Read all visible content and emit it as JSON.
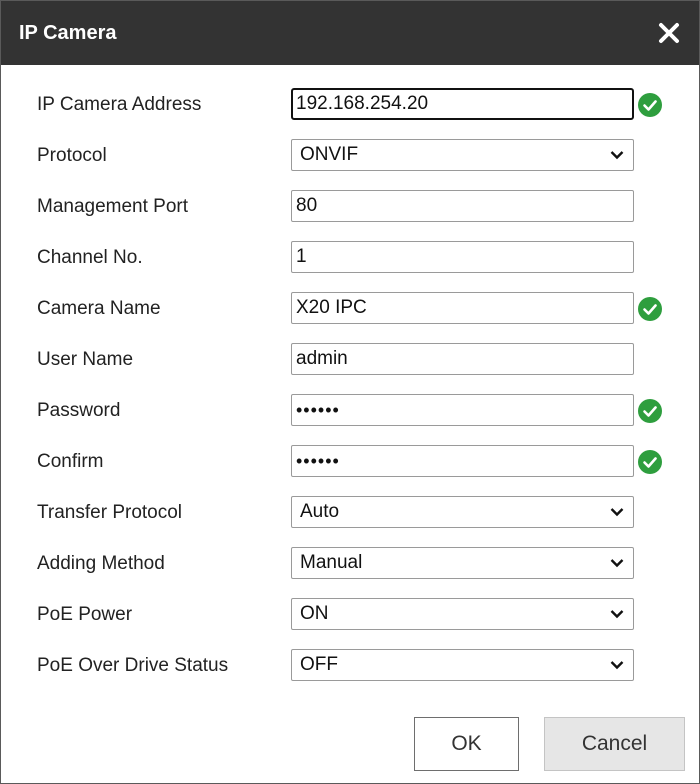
{
  "dialog": {
    "title": "IP Camera"
  },
  "fields": {
    "ip_address": {
      "label": "IP Camera Address",
      "value": "192.168.254.20"
    },
    "protocol": {
      "label": "Protocol",
      "value": "ONVIF"
    },
    "management_port": {
      "label": "Management Port",
      "value": "80"
    },
    "channel_no": {
      "label": "Channel No.",
      "value": "1"
    },
    "camera_name": {
      "label": "Camera Name",
      "value": "X20 IPC"
    },
    "user_name": {
      "label": "User Name",
      "value": "admin"
    },
    "password": {
      "label": "Password",
      "value": "••••••"
    },
    "confirm": {
      "label": "Confirm",
      "value": "••••••"
    },
    "transfer_protocol": {
      "label": "Transfer Protocol",
      "value": "Auto"
    },
    "adding_method": {
      "label": "Adding Method",
      "value": "Manual"
    },
    "poe_power": {
      "label": "PoE Power",
      "value": "ON"
    },
    "poe_over_drive": {
      "label": "PoE Over Drive Status",
      "value": "OFF"
    }
  },
  "buttons": {
    "ok": "OK",
    "cancel": "Cancel"
  },
  "icons": {
    "close": "close-icon",
    "valid": "check-circle-icon",
    "dropdown": "chevron-down-icon"
  },
  "colors": {
    "titlebar": "#333333",
    "valid_green": "#2e9e3e"
  }
}
